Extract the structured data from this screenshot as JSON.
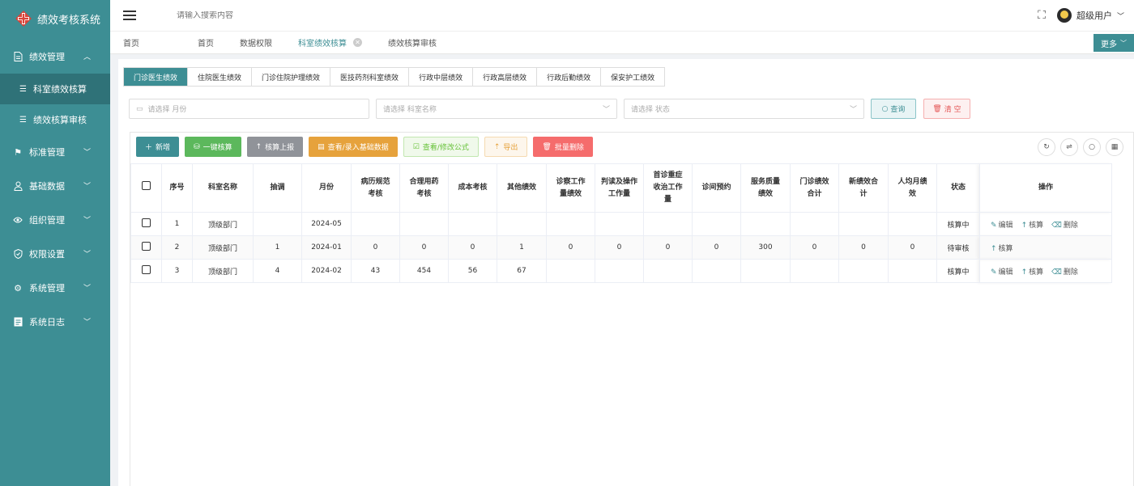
{
  "app": {
    "title": "绩效考核系统",
    "brand_color": "#3d8e94",
    "logo_icon": "cross-diamond-logo"
  },
  "sidebar": {
    "items": [
      {
        "label": "绩效管理",
        "icon": "document-icon",
        "expanded": true
      },
      {
        "label": "科室绩效核算",
        "icon": "list-icon",
        "active": true
      },
      {
        "label": "绩效核算审核",
        "icon": "list-icon"
      },
      {
        "label": "标准管理",
        "icon": "flag-icon"
      },
      {
        "label": "基础数据",
        "icon": "user-icon"
      },
      {
        "label": "组织管理",
        "icon": "eye-icon"
      },
      {
        "label": "权限设置",
        "icon": "shield-icon"
      },
      {
        "label": "系统管理",
        "icon": "gear-icon"
      },
      {
        "label": "系统日志",
        "icon": "log-icon"
      }
    ]
  },
  "header": {
    "search_placeholder": "请输入搜索内容",
    "user_name": "超级用户"
  },
  "page_tabs": {
    "items": [
      {
        "label": "首页"
      },
      {
        "label": "首页"
      },
      {
        "label": "数据权限"
      },
      {
        "label": "科室绩效核算",
        "active": true,
        "closable": true
      },
      {
        "label": "绩效核算审核"
      }
    ],
    "more_label": "更多"
  },
  "category_tabs": [
    "门诊医生绩效",
    "住院医生绩效",
    "门诊住院护理绩效",
    "医技药剂科室绩效",
    "行政中层绩效",
    "行政高层绩效",
    "行政后勤绩效",
    "保安护工绩效"
  ],
  "filters": {
    "month_placeholder": "请选择 月份",
    "dept_placeholder": "请选择 科室名称",
    "status_placeholder": "请选择 状态",
    "query_label": "查询",
    "clear_label": "清 空"
  },
  "toolbar": {
    "add": "新增",
    "one_click_calc": "一键核算",
    "report": "核算上报",
    "view_basic": "查看/录入基础数据",
    "view_formula": "查看/修改公式",
    "export": "导出",
    "batch_delete": "批量删除"
  },
  "table": {
    "columns": [
      "序号",
      "科室名称",
      "抽调",
      "月份",
      "病历规范考核",
      "合理用药考核",
      "成本考核",
      "其他绩效",
      "诊察工作量绩效",
      "判读及操作工作量",
      "首诊重症收治工作量",
      "诊间预约",
      "服务质量绩效",
      "门诊绩效合计",
      "新绩效合计",
      "人均月绩效",
      "状态",
      "操作"
    ],
    "rows": [
      {
        "cells": [
          "1",
          "顶级部门",
          "",
          "2024-05",
          "",
          "",
          "",
          "",
          "",
          "",
          "",
          "",
          "",
          "",
          "",
          "",
          "核算中"
        ],
        "ops": [
          "编辑",
          "核算",
          "删除"
        ]
      },
      {
        "cells": [
          "2",
          "顶级部门",
          "1",
          "2024-01",
          "0",
          "0",
          "0",
          "1",
          "0",
          "0",
          "0",
          "0",
          "300",
          "0",
          "0",
          "0",
          "待审核"
        ],
        "ops": [
          "核算"
        ]
      },
      {
        "cells": [
          "3",
          "顶级部门",
          "4",
          "2024-02",
          "43",
          "454",
          "56",
          "67",
          "",
          "",
          "",
          "",
          "",
          "",
          "",
          "",
          "核算中"
        ],
        "ops": [
          "编辑",
          "核算",
          "删除"
        ]
      }
    ]
  }
}
